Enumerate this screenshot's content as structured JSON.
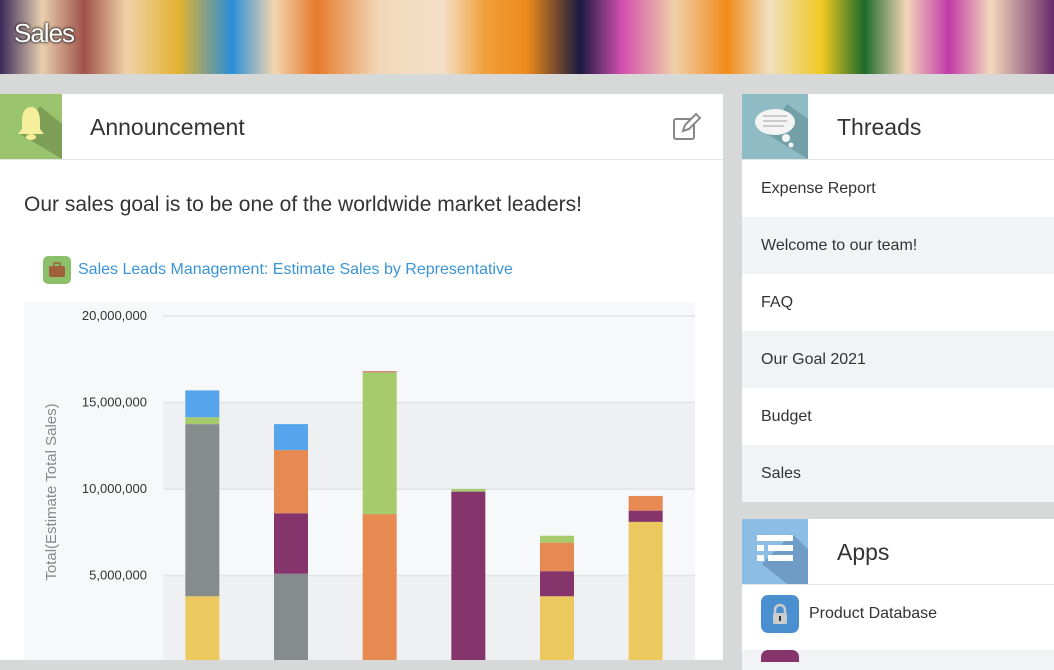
{
  "header": {
    "title": "Sales"
  },
  "announcement": {
    "title": "Announcement",
    "message": "Our sales goal is to be one of the worldwide market leaders!",
    "app_link": "Sales Leads Management: Estimate Sales by Representative"
  },
  "threads": {
    "title": "Threads",
    "items": [
      "Expense Report",
      "Welcome to our team!",
      "FAQ",
      "Our Goal 2021",
      "Budget",
      "Sales"
    ]
  },
  "apps": {
    "title": "Apps",
    "items": [
      "Product Database"
    ]
  },
  "chart_data": {
    "type": "bar",
    "stacked": true,
    "title": "",
    "ylabel": "Total(Estimate Total Sales)",
    "xlabel": "",
    "ylim": [
      0,
      20000000
    ],
    "yticks": [
      "5,000,000",
      "10,000,000",
      "15,000,000",
      "20,000,000"
    ],
    "ytick_values": [
      5000000,
      10000000,
      15000000,
      20000000
    ],
    "grid": true,
    "categories": [
      "",
      "",
      "",
      "",
      "",
      ""
    ],
    "series": [
      {
        "color": "#ebc95e",
        "values": [
          3800000,
          0,
          0,
          0,
          3800000,
          8100000
        ]
      },
      {
        "color": "#868c8c",
        "values": [
          9950000,
          5100000,
          0,
          0,
          0,
          0
        ]
      },
      {
        "color": "#86356c",
        "values": [
          0,
          3500000,
          50000,
          9850000,
          1450000,
          650000
        ]
      },
      {
        "color": "#e68a52",
        "values": [
          0,
          3650000,
          8500000,
          0,
          1650000,
          850000
        ]
      },
      {
        "color": "#a6cb6c",
        "values": [
          400000,
          0,
          8200000,
          150000,
          400000,
          0
        ]
      },
      {
        "color": "#55a4ec",
        "values": [
          1550000,
          1500000,
          0,
          0,
          0,
          0
        ]
      },
      {
        "color": "#c84a3c",
        "values": [
          0,
          0,
          50000,
          0,
          0,
          0
        ]
      }
    ]
  }
}
